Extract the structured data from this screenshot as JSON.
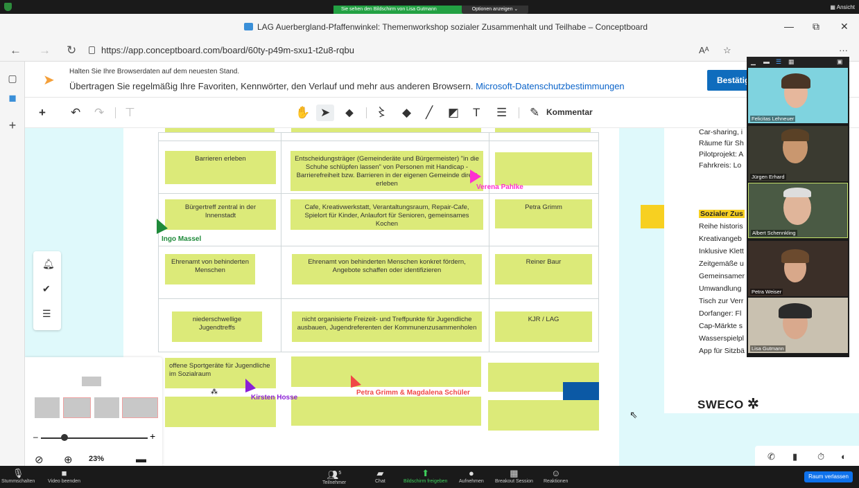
{
  "zoom": {
    "share_banner": "Sie sehen den Bildschirm von Lisa Gutmann",
    "options": "Optionen anzeigen ⌄",
    "view": "Ansicht"
  },
  "browser": {
    "title": "LAG Auerbergland-Pfaffenwinkel: Themenworkshop sozialer Zusammenhalt und Teilhabe – Conceptboard",
    "url": "https://app.conceptboard.com/board/60ty-p49m-sxu1-t2u8-rqbu"
  },
  "infobar": {
    "line1": "Halten Sie Ihre Browserdaten auf dem neuesten Stand.",
    "line2": "Übertragen Sie regelmäßig Ihre Favoriten, Kennwörter, den Verlauf und mehr aus anderen Browsern.",
    "link": "Microsoft-Datenschutzbestimmungen",
    "button": "Bestätig"
  },
  "toolbar": {
    "kommentar": "Kommentar"
  },
  "stickies": {
    "r1c1": "Barrieren erleben",
    "r1c2": "Entscheidungsträger (Gemeinderäte und Bürgermeister) \"in die Schuhe schlüpfen lassen\" von Personen mit Handicap - Barrierefreiheit bzw. Barrieren in der eigenen Gemeinde direkt erleben",
    "r2c1": "Bürgertreff zentral in der Innenstadt",
    "r2c2": "Cafe, Kreativwerkstatt, Verantaltungsraum, Repair-Cafe, Spielort für Kinder, Anlaufort für Senioren, gemeinsames Kochen",
    "r2c3": "Petra Grimm",
    "r3c1": "Ehrenamt von behinderten Menschen",
    "r3c2": "Ehrenamt von behinderten Menschen konkret fördern, Angebote schaffen oder identifizieren",
    "r3c3": "Reiner Baur",
    "r4c1": "niederschwellige Jugendtreffs",
    "r4c2": "nicht organisierte Freizeit- und Treffpunkte für Jugendliche ausbauen, Jugendreferenten der Kommunenzusammenholen",
    "r4c3": "KJR / LAG",
    "r5c1": "offene Sportgeräte für Jugendliche im Sozialraum"
  },
  "cursors": {
    "verena": "Verena Pahlke",
    "ingo": "Ingo Massel",
    "kirsten": "Kirsten Hosse",
    "petra": "Petra Grimm & Magdalena Schüler",
    "colors": {
      "verena": "#ff2ed1",
      "ingo": "#1e8a3a",
      "kirsten": "#8b1fd6",
      "petra": "#f04747"
    }
  },
  "right_panel": {
    "lines": [
      "Car-sharing, i",
      "Räume für Sh",
      "Pilotprojekt: A",
      "Fahrkreis: Lo"
    ],
    "heading": "Sozialer Zus",
    "items": [
      "Reihe historis",
      "Kreativangeb",
      "Inklusive Klett",
      "Zeitgemäße u",
      "Gemeinsamer",
      "Umwandlung",
      "Tisch zur Verr",
      "Dorfanger: Fl",
      "Cap-Märkte s",
      "Wasserspielpl",
      "App für Sitzbä"
    ],
    "logo": "SWECO"
  },
  "navigator": {
    "zoom": "23%"
  },
  "participants": [
    "Felicitas Lehneuer",
    "Jürgen Erhard",
    "Albert Schennkling",
    "Petra Weiser",
    "Lisa Gutmann"
  ],
  "zoom_bar": {
    "mute": "Stummschalten",
    "video": "Video beenden",
    "participants": "Teilnehmer",
    "participants_count": "5",
    "chat": "Chat",
    "share": "Bildschirm freigeben",
    "record": "Aufnehmen",
    "breakout": "Breakout Session",
    "reactions": "Reaktionen",
    "leave": "Raum verlassen"
  }
}
